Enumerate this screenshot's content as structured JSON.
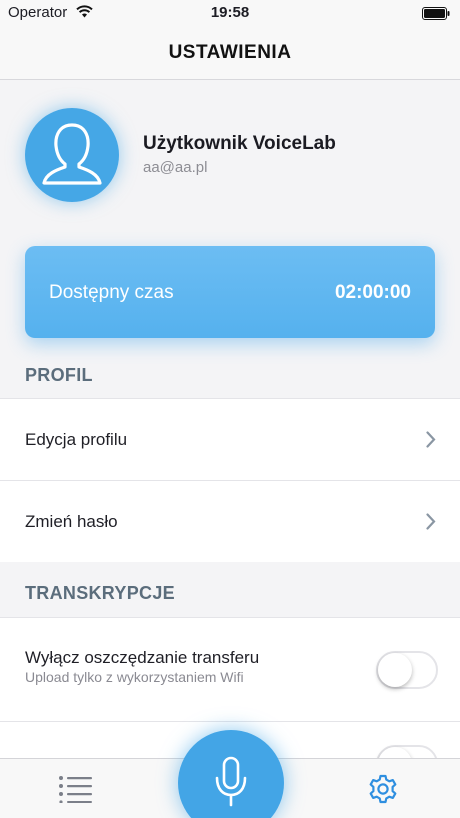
{
  "status_bar": {
    "carrier": "Operator",
    "time": "19:58"
  },
  "header": {
    "title": "USTAWIENIA"
  },
  "profile": {
    "name": "Użytkownik VoiceLab",
    "email": "aa@aa.pl"
  },
  "time_card": {
    "label": "Dostępny czas",
    "value": "02:00:00"
  },
  "sections": {
    "profil": {
      "title": "PROFIL",
      "items": [
        {
          "label": "Edycja profilu"
        },
        {
          "label": "Zmień hasło"
        }
      ]
    },
    "transkrypcje": {
      "title": "TRANSKRYPCJE",
      "items": [
        {
          "label": "Wyłącz oszczędzanie transferu",
          "sublabel": "Upload tylko z wykorzystaniem Wifi",
          "toggle_on": false
        },
        {
          "toggle_on": false
        }
      ]
    }
  },
  "colors": {
    "accent": "#45a7e6",
    "section_title": "#5b6d7c",
    "tab_active": "#2f8fe0"
  },
  "tab_bar": {
    "tabs": [
      "list-icon",
      "microphone-icon",
      "gear-icon"
    ],
    "active": "gear-icon"
  }
}
